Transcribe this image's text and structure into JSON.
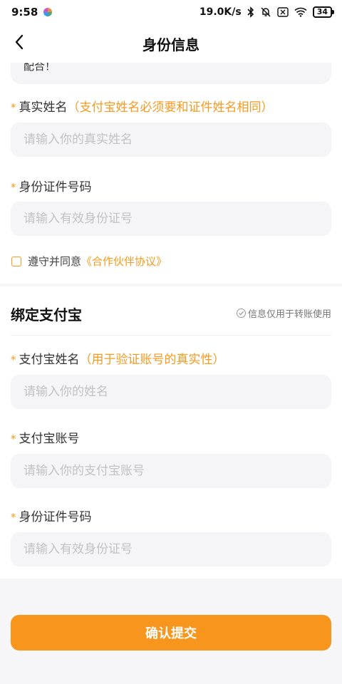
{
  "status_bar": {
    "time": "9:58",
    "network_speed": "19.0K/s",
    "battery": "34"
  },
  "header": {
    "title": "身份信息"
  },
  "notice": {
    "text_tail": "配合！"
  },
  "identity": {
    "name_label": "真实姓名",
    "name_hint": "（支付宝姓名必须要和证件姓名相同）",
    "name_placeholder": "请输入你的真实姓名",
    "id_label": "身份证件号码",
    "id_placeholder": "请输入有效身份证号",
    "agree_text": "遵守并同意",
    "agree_link": "《合作伙伴协议》"
  },
  "alipay": {
    "title": "绑定支付宝",
    "note": "信息仅用于转账使用",
    "name_label": "支付宝姓名",
    "name_hint": "（用于验证账号的真实性）",
    "name_placeholder": "请输入你的姓名",
    "account_label": "支付宝账号",
    "account_placeholder": "请输入你的支付宝账号",
    "id_label": "身份证件号码",
    "id_placeholder": "请输入有效身份证号"
  },
  "actions": {
    "submit_label": "确认提交"
  },
  "colors": {
    "accent": "#f7951c",
    "field_bg": "#f5f5f7",
    "page_bg": "#f6f6f8"
  },
  "icons": {
    "back": "chevron-left-icon",
    "bluetooth": "bluetooth-icon",
    "mute": "bell-off-icon",
    "wifi": "wifi-icon",
    "battery": "battery-icon",
    "checkbox": "checkbox-icon",
    "check_circle": "check-circle-icon"
  }
}
